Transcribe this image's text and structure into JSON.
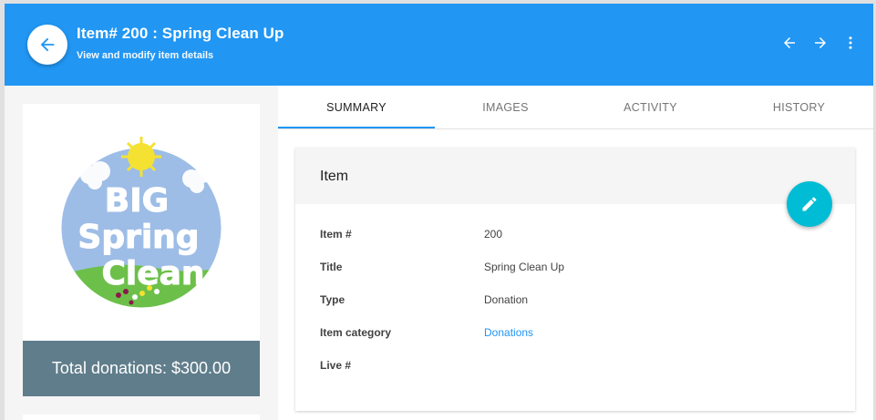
{
  "header": {
    "title": "Item# 200 : Spring Clean Up",
    "subtitle": "View and modify item details",
    "bg_color": "#2196f3",
    "back_icon": "arrow-left-icon",
    "prev_icon": "arrow-left-icon",
    "next_icon": "arrow-right-icon",
    "more_icon": "more-vert-icon"
  },
  "sidebar": {
    "logo_alt": "Big Spring Clean",
    "logo_text": [
      "BIG",
      "Spring",
      "Clean"
    ],
    "total_label": "Total donations: $300.00",
    "total_bg": "#607d8b"
  },
  "tabs": [
    {
      "label": "SUMMARY",
      "active": true
    },
    {
      "label": "IMAGES",
      "active": false
    },
    {
      "label": "ACTIVITY",
      "active": false
    },
    {
      "label": "HISTORY",
      "active": false
    }
  ],
  "item_card": {
    "title": "Item",
    "edit_icon": "pencil-icon",
    "fab_color": "#00bcd4",
    "fields": [
      {
        "label": "Item #",
        "value": "200"
      },
      {
        "label": "Title",
        "value": "Spring Clean Up"
      },
      {
        "label": "Type",
        "value": "Donation"
      },
      {
        "label": "Item category",
        "value": "Donations",
        "link": true
      },
      {
        "label": "Live #",
        "value": ""
      }
    ]
  }
}
